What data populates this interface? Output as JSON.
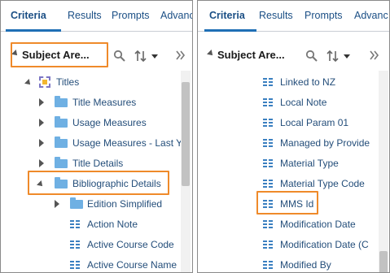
{
  "left_panel": {
    "tabs": [
      "Criteria",
      "Results",
      "Prompts",
      "Advanc"
    ],
    "subject_area_title": "Subject Are...",
    "tree": [
      {
        "label": "Titles",
        "kind": "subject",
        "expanded": true
      },
      {
        "label": "Title Measures",
        "kind": "folder"
      },
      {
        "label": "Usage Measures",
        "kind": "folder"
      },
      {
        "label": "Usage Measures - Last Y",
        "kind": "folder"
      },
      {
        "label": "Title Details",
        "kind": "folder"
      },
      {
        "label": "Bibliographic Details",
        "kind": "folder",
        "expanded": true
      },
      {
        "label": "Edition Simplified",
        "kind": "folder"
      },
      {
        "label": "Action Note",
        "kind": "column"
      },
      {
        "label": "Active Course Code",
        "kind": "column"
      },
      {
        "label": "Active Course Name",
        "kind": "column"
      }
    ]
  },
  "right_panel": {
    "tabs": [
      "Criteria",
      "Results",
      "Prompts",
      "Advanc"
    ],
    "subject_area_title": "Subject Are...",
    "tree": [
      {
        "label": "Linked to NZ",
        "kind": "column"
      },
      {
        "label": "Local Note",
        "kind": "column"
      },
      {
        "label": "Local Param 01",
        "kind": "column"
      },
      {
        "label": "Managed by Provide",
        "kind": "column"
      },
      {
        "label": "Material Type",
        "kind": "column"
      },
      {
        "label": "Material Type Code",
        "kind": "column"
      },
      {
        "label": "MMS Id",
        "kind": "column"
      },
      {
        "label": "Modification Date",
        "kind": "column"
      },
      {
        "label": "Modification Date (C",
        "kind": "column"
      },
      {
        "label": "Modified By",
        "kind": "column"
      }
    ]
  },
  "colors": {
    "highlight": "#ef8a2a",
    "tab_accent": "#1f6fb5",
    "folder": "#6fb0e3",
    "column_icon": "#3a7fc0",
    "link_text": "#244e7a"
  },
  "icons": {
    "search": "search-icon",
    "sort": "sort-icon",
    "expand_panel": "double-chevron-right-icon"
  }
}
